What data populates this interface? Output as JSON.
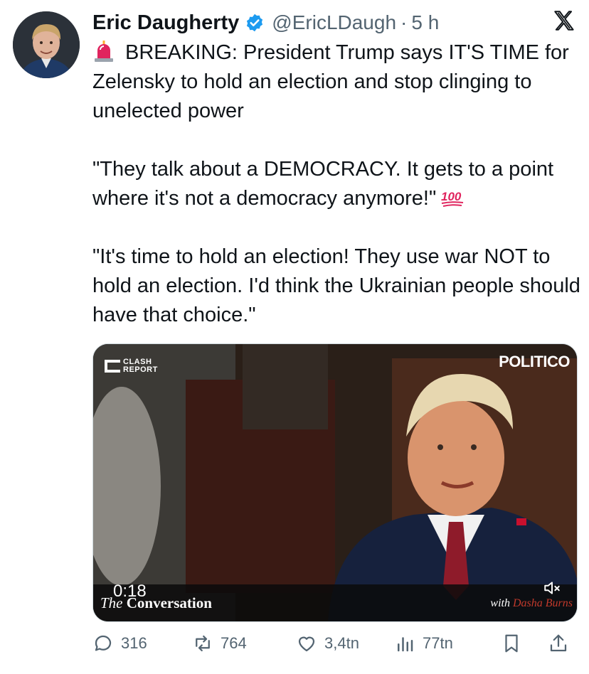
{
  "author": {
    "name": "Eric Daugherty",
    "handle": "@EricLDaugh",
    "separator": "·",
    "time": "5 h"
  },
  "tweet": {
    "line1": "BREAKING: President Trump says IT'S TIME for Zelensky to hold an election and stop clinging to unelected power",
    "quote1": "\"They talk about a DEMOCRACY. It gets to a point where it's not a democracy anymore!\"",
    "quote2": "\"It's time to hold an election! They use war NOT to hold an election. I'd think the Ukrainian people should have that choice.\""
  },
  "media": {
    "brand_left_top": "CLASH",
    "brand_left_bottom": "REPORT",
    "brand_right": "POLITICO",
    "duration": "0:18",
    "show_prefix": "The",
    "show_name": "Conversation",
    "with_prefix": "with",
    "with_name": "Dasha Burns"
  },
  "metrics": {
    "replies": "316",
    "retweets": "764",
    "likes": "3,4tn",
    "views": "77tn"
  },
  "colors": {
    "text": "#0f1419",
    "muted": "#536471",
    "verified": "#1d9bf0",
    "accent_red": "#c0392b"
  },
  "icons": [
    "verified-icon",
    "x-logo-icon",
    "siren-icon",
    "hundred-icon",
    "mute-icon",
    "reply-icon",
    "retweet-icon",
    "like-icon",
    "views-icon",
    "bookmark-icon",
    "share-icon"
  ]
}
